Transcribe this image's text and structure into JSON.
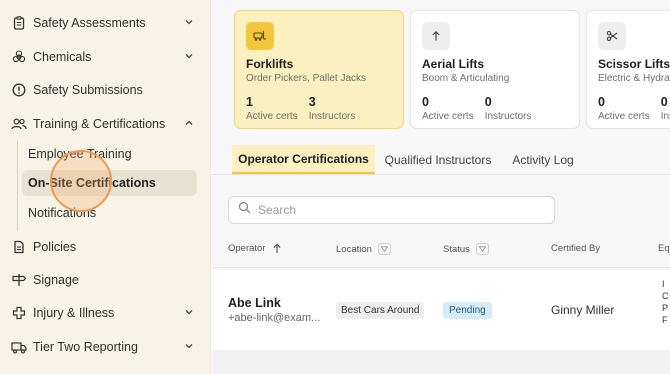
{
  "sidebar": {
    "items": [
      {
        "label": "Safety Assessments",
        "icon": "clipboard-icon",
        "chevron": "down"
      },
      {
        "label": "Chemicals",
        "icon": "biohazard-icon",
        "chevron": "down"
      },
      {
        "label": "Safety Submissions",
        "icon": "alert-circle-icon"
      },
      {
        "label": "Training & Certifications",
        "icon": "users-icon",
        "chevron": "up"
      },
      {
        "label": "Policies",
        "icon": "document-icon"
      },
      {
        "label": "Signage",
        "icon": "signpost-icon"
      },
      {
        "label": "Injury & Illness",
        "icon": "medical-cross-icon",
        "chevron": "down"
      },
      {
        "label": "Tier Two Reporting",
        "icon": "truck-icon",
        "chevron": "down"
      }
    ],
    "sub_items": [
      {
        "label": "Employee Training"
      },
      {
        "label": "On-Site Certifications",
        "active": true
      },
      {
        "label": "Notifications"
      }
    ]
  },
  "equipment_cards": [
    {
      "name": "Forklifts",
      "subtitle": "Order Pickers, Pallet Jacks",
      "icon": "forklift-icon",
      "active_certs": "1",
      "active_certs_label": "Active certs",
      "instructors": "3",
      "instructors_label": "Instructors",
      "selected": true
    },
    {
      "name": "Aerial Lifts",
      "subtitle": "Boom & Articulating",
      "icon": "arrow-up-icon",
      "active_certs": "0",
      "active_certs_label": "Active certs",
      "instructors": "0",
      "instructors_label": "Instructors"
    },
    {
      "name": "Scissor Lifts",
      "subtitle": "Electric & Hydraulic",
      "icon": "scissors-icon",
      "active_certs": "0",
      "active_certs_label": "Active certs",
      "instructors": "0",
      "instructors_label": "Instructors"
    }
  ],
  "tabs": [
    {
      "label": "Operator Certifications",
      "active": true
    },
    {
      "label": "Qualified Instructors"
    },
    {
      "label": "Activity Log"
    }
  ],
  "search": {
    "placeholder": "Search"
  },
  "table": {
    "columns": [
      "Operator",
      "Location",
      "Status",
      "Certified By",
      "Equ"
    ],
    "rows": [
      {
        "operator_name": "Abe Link",
        "operator_email": "+abe-link@exam...",
        "location": "Best Cars Around",
        "status": "Pending",
        "certified_by": "Ginny Miller",
        "equipment": [
          "I",
          "C",
          "P",
          "F"
        ]
      }
    ]
  },
  "colors": {
    "accent": "#f3c73d",
    "accent_bg": "#fcf0c0",
    "status_pending_bg": "#d6ecfb",
    "sidebar_bg": "#f7f3e8"
  }
}
